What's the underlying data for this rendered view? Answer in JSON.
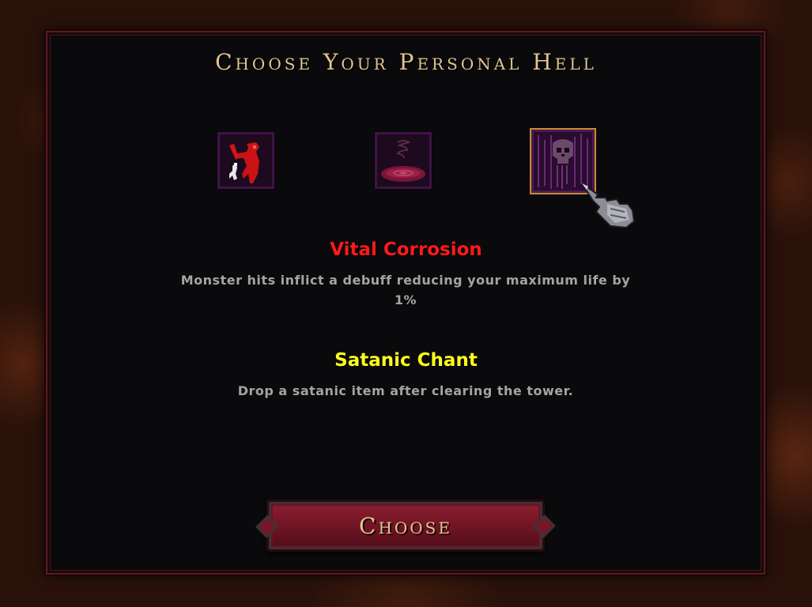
{
  "title": "Choose Your Personal Hell",
  "icons": [
    {
      "name": "demon-slayer-icon",
      "selected": false
    },
    {
      "name": "blood-pool-icon",
      "selected": false
    },
    {
      "name": "weeping-skull-icon",
      "selected": true
    }
  ],
  "effects": [
    {
      "name": "Vital Corrosion",
      "color": "#ff1a1a",
      "description": "Monster hits inflict a debuff reducing your maximum life by 1%"
    },
    {
      "name": "Satanic Chant",
      "color": "#ffff1e",
      "description": "Drop a satanic item after clearing the tower."
    }
  ],
  "choose_button": {
    "label": "Choose"
  },
  "colors": {
    "title_gold": "#e0c590",
    "panel_bg": "#0a0a0c",
    "button_red": "#8d1e31",
    "selection_outline": "#c98a2e",
    "description_grey": "#a7a3a0"
  }
}
